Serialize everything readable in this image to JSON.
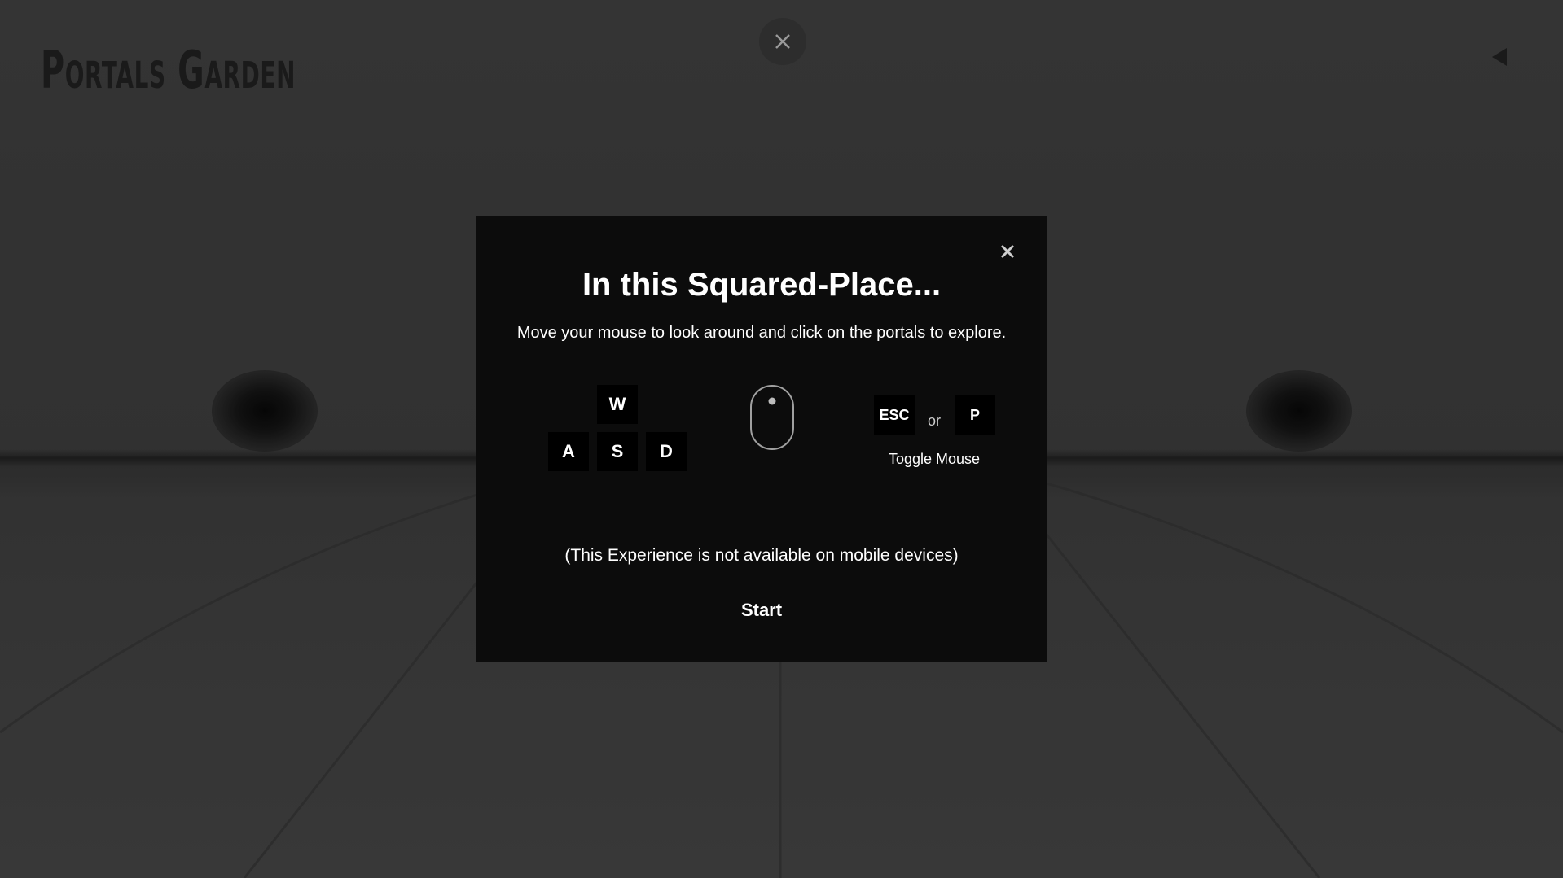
{
  "app": {
    "logo_text": "Portals Garden"
  },
  "top_close": {
    "icon": "close-icon"
  },
  "back_button": {
    "icon": "back-arrow-icon"
  },
  "modal": {
    "title": "In this Squared-Place...",
    "subtitle": "Move your mouse to look around and click on the portals to explore.",
    "keys": {
      "w": "W",
      "a": "A",
      "s": "S",
      "d": "D",
      "esc": "ESC",
      "p": "P"
    },
    "or_text": "or",
    "toggle_label": "Toggle Mouse",
    "mobile_note": "(This Experience is not available on mobile devices)",
    "start_label": "Start",
    "close_icon": "close-icon",
    "mouse_icon": "mouse-icon"
  },
  "colors": {
    "background": "#3a3a3a",
    "modal": "#0c0c0c",
    "key": "#000000",
    "text": "#ffffff"
  }
}
